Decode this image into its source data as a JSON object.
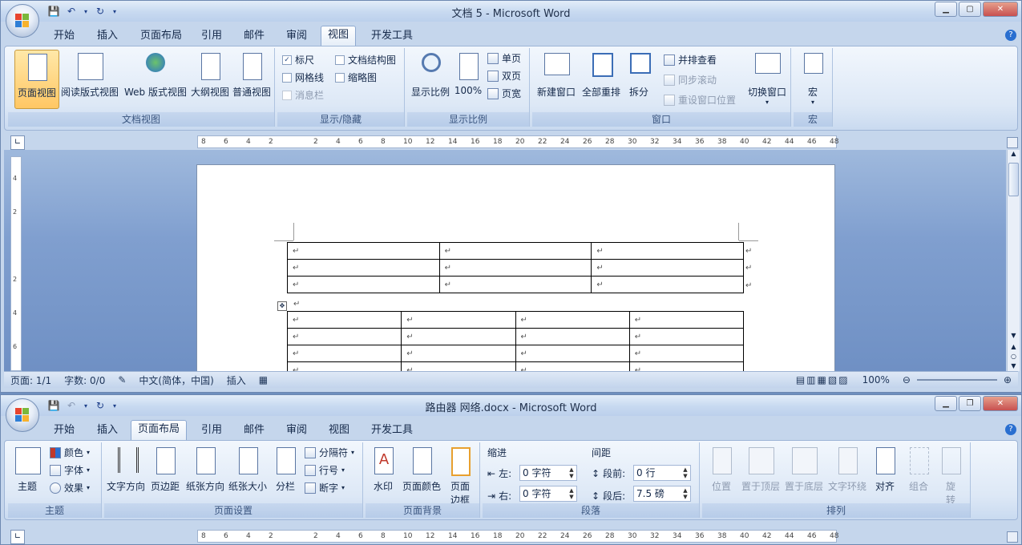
{
  "win1": {
    "title": "文档 5 - Microsoft Word",
    "tabs": [
      "开始",
      "插入",
      "页面布局",
      "引用",
      "邮件",
      "审阅",
      "视图",
      "开发工具"
    ],
    "active_tab": "视图",
    "groups": {
      "doc_views": {
        "label": "文档视图",
        "buttons": [
          "页面视图",
          "阅读版式视图",
          "Web 版式视图",
          "大纲视图",
          "普通视图"
        ]
      },
      "show_hide": {
        "label": "显示/隐藏",
        "ruler": "标尺",
        "doc_map": "文档结构图",
        "gridlines": "网格线",
        "thumbnails": "缩略图",
        "message_bar": "消息栏"
      },
      "zoom": {
        "label": "显示比例",
        "zoom_btn": "显示比例",
        "pct_btn": "100%",
        "one_page": "单页",
        "two_pages": "双页",
        "page_width": "页宽"
      },
      "window": {
        "label": "窗口",
        "new_window": "新建窗口",
        "arrange_all": "全部重排",
        "split": "拆分",
        "side_by_side": "并排查看",
        "sync_scroll": "同步滚动",
        "reset_pos": "重设窗口位置",
        "switch": "切换窗口"
      },
      "macros": {
        "label": "宏",
        "btn": "宏"
      }
    },
    "ruler_h": [
      "8",
      "6",
      "4",
      "2",
      "",
      "2",
      "4",
      "6",
      "8",
      "10",
      "12",
      "14",
      "16",
      "18",
      "20",
      "22",
      "24",
      "26",
      "28",
      "30",
      "32",
      "34",
      "36",
      "38",
      "40",
      "42",
      "44",
      "46",
      "48"
    ],
    "ruler_v": [
      "4",
      "2",
      "",
      "2",
      "4",
      "6"
    ],
    "status": {
      "page": "页面: 1/1",
      "words": "字数: 0/0",
      "lang": "中文(简体，中国)",
      "mode": "插入",
      "zoom": "100%"
    }
  },
  "win2": {
    "title": "路由器 网络.docx - Microsoft Word",
    "tabs": [
      "开始",
      "插入",
      "页面布局",
      "引用",
      "邮件",
      "审阅",
      "视图",
      "开发工具"
    ],
    "active_tab": "页面布局",
    "groups": {
      "theme": {
        "label": "主题",
        "theme": "主题",
        "colors": "颜色",
        "fonts": "字体",
        "effects": "效果"
      },
      "page_setup": {
        "label": "页面设置",
        "text_dir": "文字方向",
        "margins": "页边距",
        "orientation": "纸张方向",
        "size": "纸张大小",
        "columns": "分栏",
        "breaks": "分隔符",
        "line_numbers": "行号",
        "hyphenation": "断字"
      },
      "page_bg": {
        "label": "页面背景",
        "watermark": "水印",
        "page_color": "页面颜色",
        "page_borders_1": "页面",
        "page_borders_2": "边框"
      },
      "paragraph": {
        "label": "段落",
        "indent": "缩进",
        "left": "左:",
        "left_val": "0 字符",
        "right": "右:",
        "right_val": "0 字符",
        "spacing": "间距",
        "before": "段前:",
        "before_val": "0 行",
        "after": "段后:",
        "after_val": "7.5 磅"
      },
      "arrange": {
        "label": "排列",
        "position": "位置",
        "bring_front": "置于顶层",
        "send_back": "置于底层",
        "text_wrap": "文字环绕",
        "align": "对齐",
        "group": "组合",
        "rotate_1": "旋",
        "rotate_2": "转"
      }
    },
    "ruler_h": [
      "8",
      "6",
      "4",
      "2",
      "",
      "2",
      "4",
      "6",
      "8",
      "10",
      "12",
      "14",
      "16",
      "18",
      "20",
      "22",
      "24",
      "26",
      "28",
      "30",
      "32",
      "34",
      "36",
      "38",
      "40",
      "42",
      "44",
      "46",
      "48"
    ]
  },
  "colors": {
    "ribbon": "#dde8f6",
    "accent": "#2a6fd0",
    "active_btn": "#ffc764"
  }
}
